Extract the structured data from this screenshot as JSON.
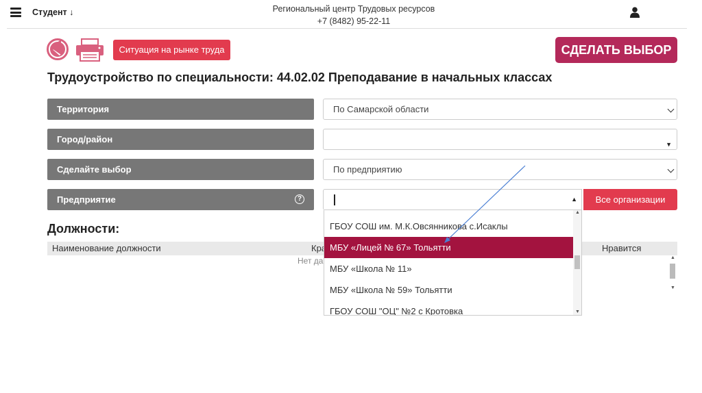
{
  "header": {
    "role": "Студент",
    "title_line1": "Региональный центр Трудовых ресурсов",
    "title_line2": "+7 (8482) 95-22-11"
  },
  "toolbar": {
    "market_button": "Ситуация на рынке труда",
    "choose_button": "СДЕЛАТЬ ВЫБОР"
  },
  "page_title": "Трудоустройство по специальности: 44.02.02 Преподавание в начальных классах",
  "form": {
    "territory_label": "Территория",
    "territory_value": "По Самарской области",
    "city_label": "Город/район",
    "city_value": "",
    "choice_label": "Сделайте выбор",
    "choice_value": "По предприятию",
    "enterprise_label": "Предприятие",
    "enterprise_value": "",
    "all_orgs_button": "Все организации"
  },
  "dropdown": {
    "items": [
      "ГБОУ СОШ им. М.К.Овсянникова с.Исаклы",
      "МБУ «Лицей № 67» Тольятти",
      "МБУ «Школа № 11»",
      "МБУ «Школа № 59» Тольятти",
      "ГБОУ СОШ \"ОЦ\" №2 с Кротовка"
    ],
    "selected_index": 1
  },
  "positions": {
    "title": "Должности:",
    "col_name": "Наименование должности",
    "col_short": "Кра",
    "col_like": "Нравится",
    "empty": "Нет да"
  },
  "colors": {
    "accent_red": "#e23b4e",
    "choose_bg": "#b4295a",
    "selected_item": "#a3133f",
    "label_bg": "#777777"
  }
}
